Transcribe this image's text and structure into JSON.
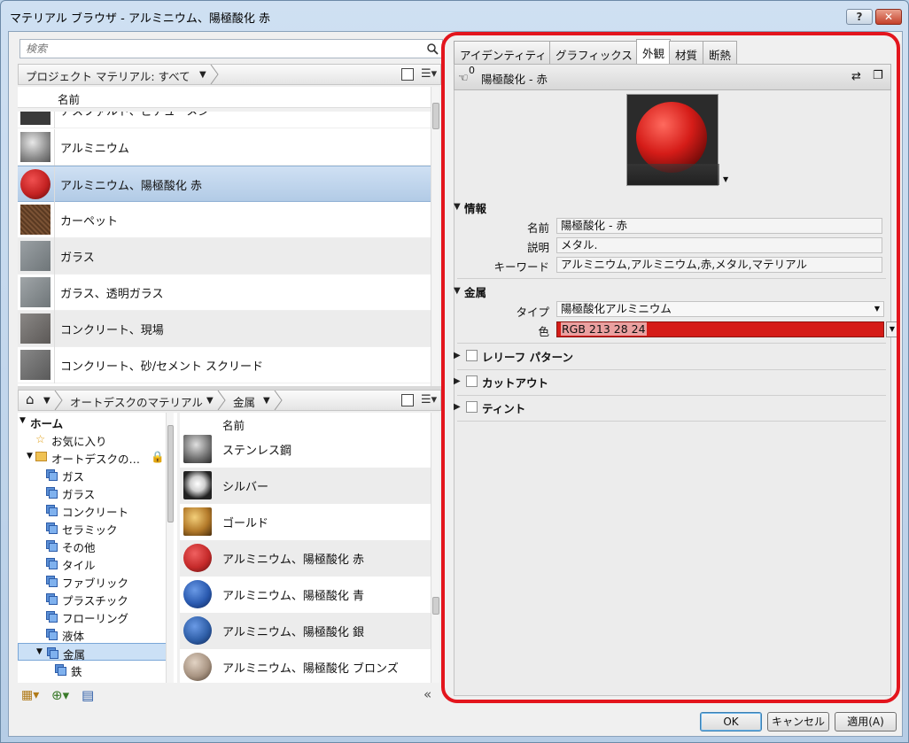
{
  "window": {
    "title": "マテリアル ブラウザ - アルミニウム、陽極酸化 赤",
    "help_label": "?",
    "close_label": "✕"
  },
  "search": {
    "placeholder": "検索"
  },
  "project_bar": {
    "label": "プロジェクト マテリアル: すべて"
  },
  "project_list": {
    "header": "名前",
    "items": [
      {
        "label": "アスファルト、ビチューメン",
        "thumb": "#3a3a3a"
      },
      {
        "label": "アルミニウム",
        "thumb": "#a7a7a7"
      },
      {
        "label": "アルミニウム、陽極酸化 赤",
        "thumb": "#c42222"
      },
      {
        "label": "カーペット",
        "thumb": "#5a3a22"
      },
      {
        "label": "ガラス",
        "thumb": "#8b9094"
      },
      {
        "label": "ガラス、透明ガラス",
        "thumb": "#8e9396"
      },
      {
        "label": "コンクリート、現場",
        "thumb": "#6e6b69"
      },
      {
        "label": "コンクリート、砂/セメント スクリード",
        "thumb": "#6a6a6a"
      }
    ]
  },
  "library_bar": {
    "home": "⌂",
    "library": "オートデスクのマテリアル",
    "category": "金属"
  },
  "tree": {
    "home": "ホーム",
    "favorites": "お気に入り",
    "autodesk": "オートデスクの…",
    "categories": [
      "ガス",
      "ガラス",
      "コンクリート",
      "セラミック",
      "その他",
      "タイル",
      "ファブリック",
      "プラスチック",
      "フローリング",
      "液体",
      "金属"
    ],
    "sub": "鉄"
  },
  "library_list": {
    "header": "名前",
    "items": [
      {
        "label": "ステンレス鋼",
        "thumb": "#8b8b8b"
      },
      {
        "label": "シルバー",
        "thumb": "#d8d8d8"
      },
      {
        "label": "ゴールド",
        "thumb": "#b37a2a"
      },
      {
        "label": "アルミニウム、陽極酸化 赤",
        "thumb": "#c52a2a"
      },
      {
        "label": "アルミニウム、陽極酸化 青",
        "thumb": "#2a5ab0"
      },
      {
        "label": "アルミニウム、陽極酸化 銀",
        "thumb": "#2f5fa8"
      },
      {
        "label": "アルミニウム、陽極酸化 ブロンズ",
        "thumb": "#a89482"
      }
    ]
  },
  "tabs": [
    "アイデンティティ",
    "グラフィックス",
    "外観",
    "材質",
    "断熱"
  ],
  "active_tab": "外観",
  "asset": {
    "count": "0",
    "name": "陽極酸化 - 赤"
  },
  "info": {
    "title": "情報",
    "name_label": "名前",
    "name_value": "陽極酸化 - 赤",
    "desc_label": "説明",
    "desc_value": "メタル.",
    "keyword_label": "キーワード",
    "keyword_value": "アルミニウム,アルミニウム,赤,メタル,マテリアル"
  },
  "metal": {
    "title": "金属",
    "type_label": "タイプ",
    "type_value": "陽極酸化アルミニウム",
    "color_label": "色",
    "color_value": "RGB 213 28 24",
    "color_hex": "#d51c18"
  },
  "options": [
    "レリーフ パターン",
    "カットアウト",
    "ティント"
  ],
  "buttons": {
    "ok": "OK",
    "cancel": "キャンセル",
    "apply": "適用(A)"
  },
  "colors": {
    "accent_frame": "#e3151d",
    "selection": "#b2cbe6"
  }
}
